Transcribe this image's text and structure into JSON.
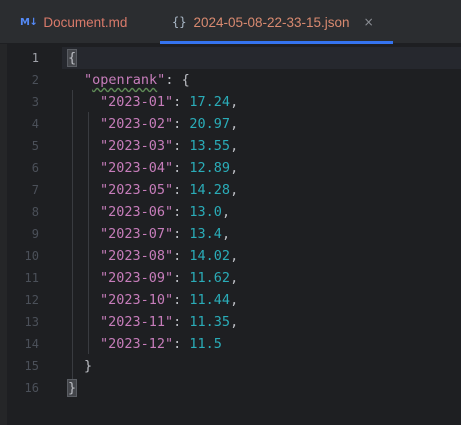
{
  "tabs": [
    {
      "icon": "M↓",
      "title": "Document.md",
      "active": false
    },
    {
      "icon": "{}",
      "title": "2024-05-08-22-33-15.json",
      "active": true,
      "close": "×"
    }
  ],
  "editor": {
    "line_numbers": [
      "1",
      "2",
      "3",
      "4",
      "5",
      "6",
      "7",
      "8",
      "9",
      "10",
      "11",
      "12",
      "13",
      "14",
      "15",
      "16"
    ],
    "lines": [
      {
        "open_brace": "{"
      },
      {
        "key": "\"openrank\"",
        "sep": ": ",
        "open": "{"
      },
      {
        "key": "\"2023-01\"",
        "sep": ": ",
        "value": "17.24",
        "comma": ","
      },
      {
        "key": "\"2023-02\"",
        "sep": ": ",
        "value": "20.97",
        "comma": ","
      },
      {
        "key": "\"2023-03\"",
        "sep": ": ",
        "value": "13.55",
        "comma": ","
      },
      {
        "key": "\"2023-04\"",
        "sep": ": ",
        "value": "12.89",
        "comma": ","
      },
      {
        "key": "\"2023-05\"",
        "sep": ": ",
        "value": "14.28",
        "comma": ","
      },
      {
        "key": "\"2023-06\"",
        "sep": ": ",
        "value": "13.0",
        "comma": ","
      },
      {
        "key": "\"2023-07\"",
        "sep": ": ",
        "value": "13.4",
        "comma": ","
      },
      {
        "key": "\"2023-08\"",
        "sep": ": ",
        "value": "14.02",
        "comma": ","
      },
      {
        "key": "\"2023-09\"",
        "sep": ": ",
        "value": "11.62",
        "comma": ","
      },
      {
        "key": "\"2023-10\"",
        "sep": ": ",
        "value": "11.44",
        "comma": ","
      },
      {
        "key": "\"2023-11\"",
        "sep": ": ",
        "value": "11.35",
        "comma": ","
      },
      {
        "key": "\"2023-12\"",
        "sep": ": ",
        "value": "11.5",
        "comma": ""
      },
      {
        "close": "}"
      },
      {
        "close_brace": "}"
      }
    ]
  },
  "colors": {
    "accent": "#3574f0",
    "key": "#c77dbb",
    "number": "#2aacb8"
  }
}
